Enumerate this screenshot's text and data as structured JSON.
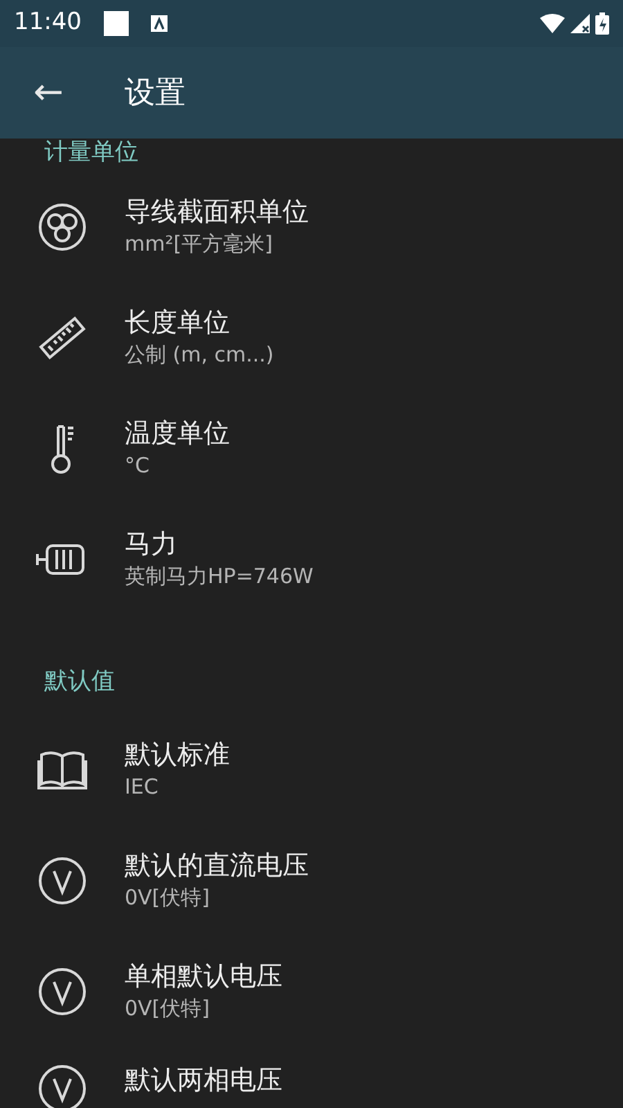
{
  "status_bar": {
    "time": "11:40"
  },
  "toolbar": {
    "back": "←",
    "title": "设置"
  },
  "sections": [
    {
      "header": "计量单位",
      "items": [
        {
          "title": "导线截面积单位",
          "value": "mm²[平方毫米]"
        },
        {
          "title": "长度单位",
          "value": "公制 (m, cm...)"
        },
        {
          "title": "温度单位",
          "value": "°C"
        },
        {
          "title": "马力",
          "value": "英制马力HP=746W"
        }
      ]
    },
    {
      "header": "默认值",
      "items": [
        {
          "title": "默认标准",
          "value": "IEC"
        },
        {
          "title": "默认的直流电压",
          "value": "0V[伏特]"
        },
        {
          "title": "单相默认电压",
          "value": "0V[伏特]"
        },
        {
          "title": "默认两相电压"
        }
      ]
    }
  ]
}
